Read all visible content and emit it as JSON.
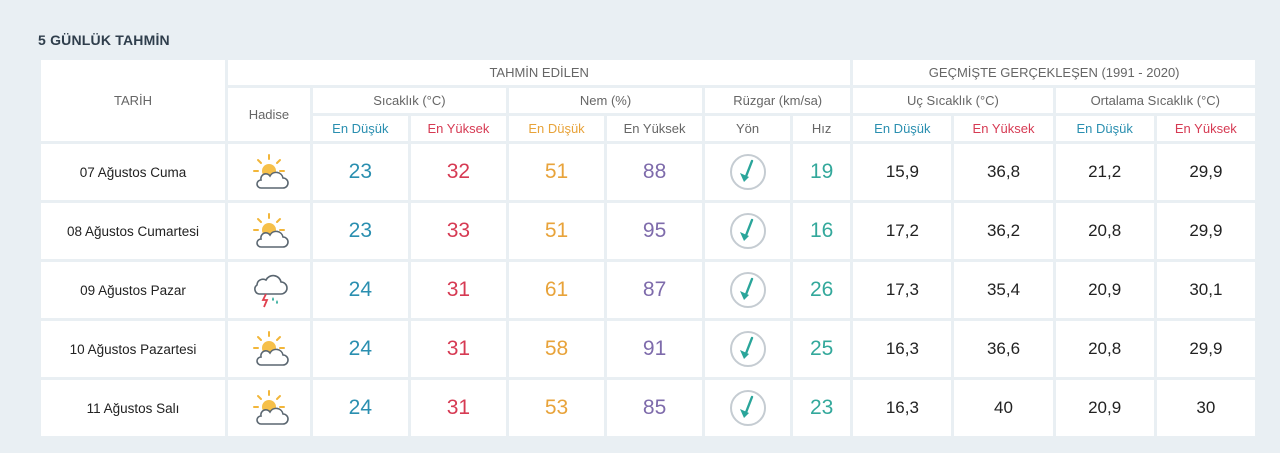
{
  "title": "5 GÜNLÜK TAHMİN",
  "headers": {
    "tarih": "TARİH",
    "tahmin_edilen": "TAHMİN EDİLEN",
    "gecmiste": "GEÇMİŞTE GERÇEKLEŞEN (1991 - 2020)",
    "hadise": "Hadise",
    "sicaklik": "Sıcaklık (°C)",
    "nem": "Nem (%)",
    "ruzgar": "Rüzgar (km/sa)",
    "uc_sicaklik": "Uç Sıcaklık (°C)",
    "ortalama_sicaklik": "Ortalama Sıcaklık (°C)",
    "en_dusuk": "En Düşük",
    "en_yuksek": "En Yüksek",
    "yon": "Yön",
    "hiz": "Hız"
  },
  "rows": [
    {
      "date": "07 Ağustos Cuma",
      "icon": "partly-cloudy-icon",
      "t_min": "23",
      "t_max": "32",
      "h_min": "51",
      "h_max": "88",
      "wind_dir": "wind-direction-icon",
      "wind_speed": "19",
      "uc_min": "15,9",
      "uc_max": "36,8",
      "ort_min": "21,2",
      "ort_max": "29,9"
    },
    {
      "date": "08 Ağustos Cumartesi",
      "icon": "partly-cloudy-icon",
      "t_min": "23",
      "t_max": "33",
      "h_min": "51",
      "h_max": "95",
      "wind_dir": "wind-direction-icon",
      "wind_speed": "16",
      "uc_min": "17,2",
      "uc_max": "36,2",
      "ort_min": "20,8",
      "ort_max": "29,9"
    },
    {
      "date": "09 Ağustos Pazar",
      "icon": "thunderstorm-rain-icon",
      "t_min": "24",
      "t_max": "31",
      "h_min": "61",
      "h_max": "87",
      "wind_dir": "wind-direction-icon",
      "wind_speed": "26",
      "uc_min": "17,3",
      "uc_max": "35,4",
      "ort_min": "20,9",
      "ort_max": "30,1"
    },
    {
      "date": "10 Ağustos Pazartesi",
      "icon": "partly-cloudy-icon",
      "t_min": "24",
      "t_max": "31",
      "h_min": "58",
      "h_max": "91",
      "wind_dir": "wind-direction-icon",
      "wind_speed": "25",
      "uc_min": "16,3",
      "uc_max": "36,6",
      "ort_min": "20,8",
      "ort_max": "29,9"
    },
    {
      "date": "11 Ağustos Salı",
      "icon": "partly-cloudy-icon",
      "t_min": "24",
      "t_max": "31",
      "h_min": "53",
      "h_max": "85",
      "wind_dir": "wind-direction-icon",
      "wind_speed": "23",
      "uc_min": "16,3",
      "uc_max": "40",
      "ort_min": "20,9",
      "ort_max": "30"
    }
  ],
  "colors": {
    "background": "#e9eff3",
    "temp_low": "#2a8fb0",
    "temp_high": "#d63a53",
    "hum_low": "#e8a33a",
    "hum_high": "#7e6bab",
    "wind_speed": "#33a89b"
  }
}
